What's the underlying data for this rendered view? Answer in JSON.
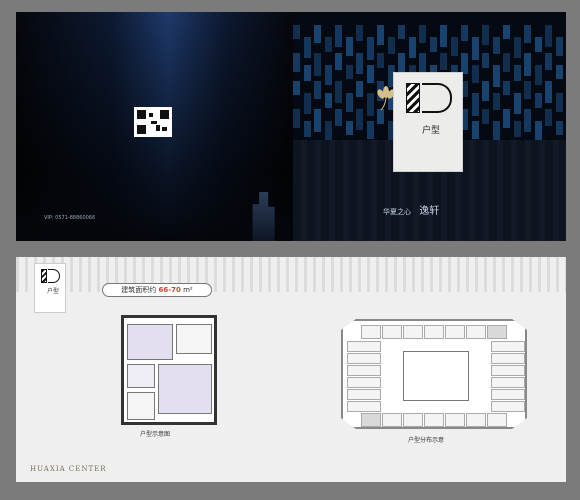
{
  "cover": {
    "contact": "VIP: 0571-88860066",
    "tag_word": "户型",
    "brand_left": "华夏之心",
    "brand_right": "逸轩"
  },
  "inner": {
    "tag_word": "户型",
    "area_prefix": "建筑面积约",
    "area_value": "66-70",
    "area_unit": "m²",
    "unit_plan_caption": "户型示意图",
    "floor_plan_caption": "户型分布示意",
    "footer_logo": "HUAXIA CENTER"
  },
  "colors": {
    "accent_blue": "#1c4d80",
    "area_red": "#d0452b"
  }
}
